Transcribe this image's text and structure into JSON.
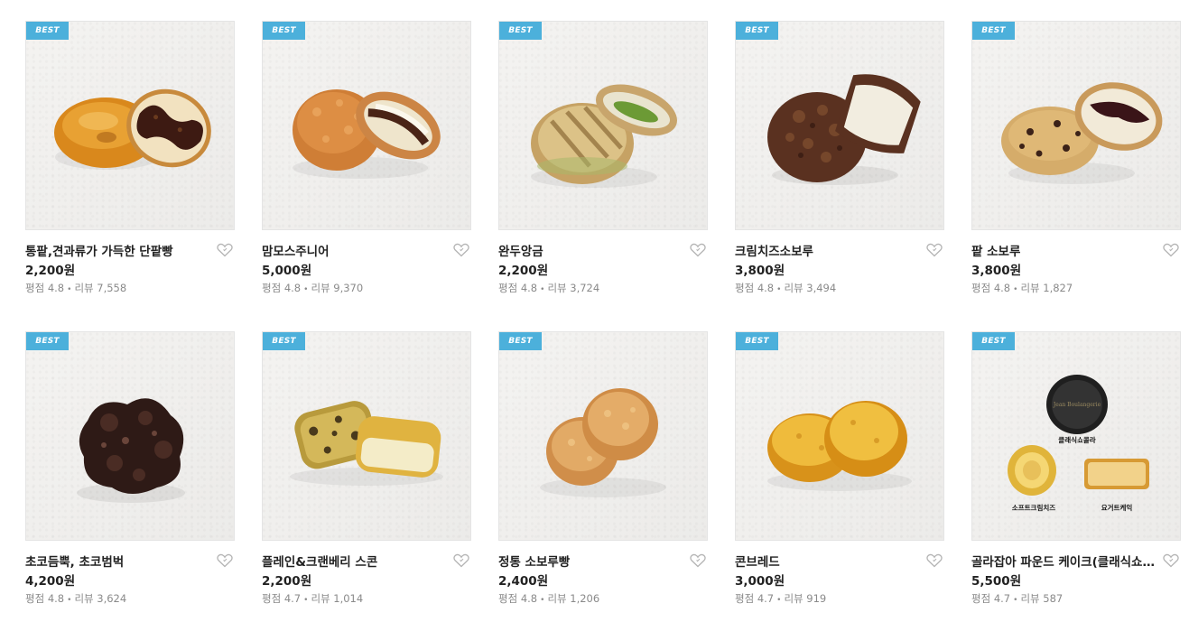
{
  "products": [
    {
      "badge": "BEST",
      "title": "통팥,견과류가 가득한 단팥빵",
      "price": "2,200원",
      "rating_label": "평점",
      "rating": "4.8",
      "review_label": "리뷰",
      "reviews": "7,558",
      "image": "red-bean-bun"
    },
    {
      "badge": "BEST",
      "title": "맘모스주니어",
      "price": "5,000원",
      "rating_label": "평점",
      "rating": "4.8",
      "review_label": "리뷰",
      "reviews": "9,370",
      "image": "mammoth-bread"
    },
    {
      "badge": "BEST",
      "title": "완두앙금",
      "price": "2,200원",
      "rating_label": "평점",
      "rating": "4.8",
      "review_label": "리뷰",
      "reviews": "3,724",
      "image": "pea-paste-bread"
    },
    {
      "badge": "BEST",
      "title": "크림치즈소보루",
      "price": "3,800원",
      "rating_label": "평점",
      "rating": "4.8",
      "review_label": "리뷰",
      "reviews": "3,494",
      "image": "cream-cheese-soboro"
    },
    {
      "badge": "BEST",
      "title": "팥 소보루",
      "price": "3,800원",
      "rating_label": "평점",
      "rating": "4.8",
      "review_label": "리뷰",
      "reviews": "1,827",
      "image": "red-bean-soboro"
    },
    {
      "badge": "BEST",
      "title": "초코듬뿍, 초코범벅",
      "price": "4,200원",
      "rating_label": "평점",
      "rating": "4.8",
      "review_label": "리뷰",
      "reviews": "3,624",
      "image": "choco-bread"
    },
    {
      "badge": "BEST",
      "title": "플레인&크랜베리 스콘",
      "price": "2,200원",
      "rating_label": "평점",
      "rating": "4.7",
      "review_label": "리뷰",
      "reviews": "1,014",
      "image": "scones"
    },
    {
      "badge": "BEST",
      "title": "정통 소보루빵",
      "price": "2,400원",
      "rating_label": "평점",
      "rating": "4.8",
      "review_label": "리뷰",
      "reviews": "1,206",
      "image": "soboro-bread"
    },
    {
      "badge": "BEST",
      "title": "콘브레드",
      "price": "3,000원",
      "rating_label": "평점",
      "rating": "4.7",
      "review_label": "리뷰",
      "reviews": "919",
      "image": "cornbread"
    },
    {
      "badge": "BEST",
      "title": "골라잡아 파운드 케이크(클래식쇼…",
      "price": "5,500원",
      "rating_label": "평점",
      "rating": "4.7",
      "review_label": "리뷰",
      "reviews": "587",
      "image": "pound-cakes",
      "image_labels": [
        "클래식쇼콜라",
        "소프트크림치즈",
        "요거트케익"
      ],
      "brand_mark": "Jean Boulangerie"
    }
  ],
  "colors": {
    "badge": "#4cb0db",
    "text": "#222222",
    "meta": "#8a8a8a"
  },
  "icons": {
    "wishlist": "heart-outline-icon"
  }
}
